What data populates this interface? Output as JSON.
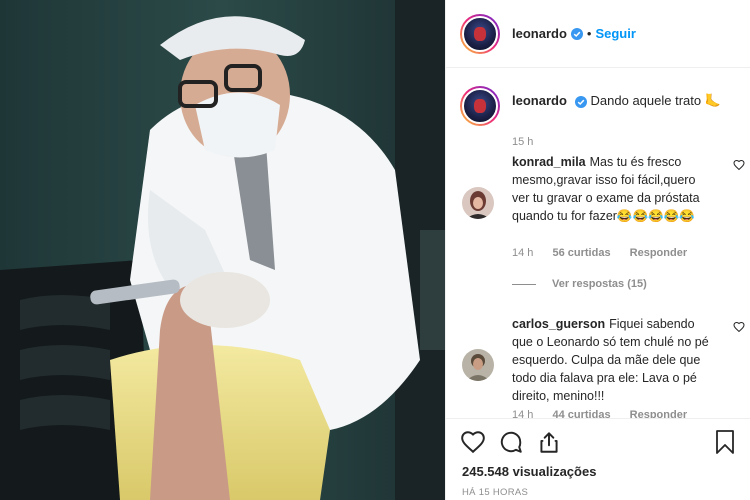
{
  "post": {
    "author": "leonardo",
    "follow_label": "Seguir",
    "caption": "Dando aquele trato",
    "caption_age": "15 h"
  },
  "comments": [
    {
      "user": "konrad_mila",
      "text": "Mas tu és fresco mesmo,gravar isso foi fácil,quero ver tu gravar o exame da próstata quando tu for fazer😂😂😂😂😂",
      "age": "14 h",
      "likes": "56 curtidas",
      "reply": "Responder",
      "view_replies": "Ver respostas (15)"
    },
    {
      "user": "carlos_guerson",
      "text": "Fiquei sabendo que o Leonardo só tem chulé no pé esquerdo. Culpa da mãe dele que todo dia falava pra ele: Lava o pé direito, menino!!!",
      "age": "14 h",
      "likes": "44 curtidas",
      "reply": "Responder"
    }
  ],
  "stats": {
    "views": "245.548 visualizações",
    "posted": "HÁ 15 HORAS"
  },
  "colors": {
    "accent": "#0095f6",
    "muted": "#8e8e8e",
    "border": "#efefef"
  },
  "icons": [
    "heart-icon",
    "comment-icon",
    "share-icon",
    "bookmark-icon",
    "verified-icon",
    "foot-emoji"
  ]
}
